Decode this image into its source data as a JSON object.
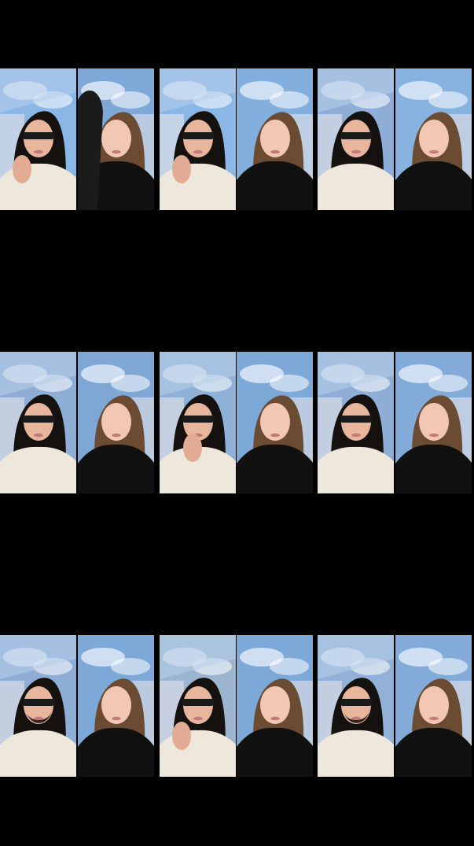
{
  "rows": [
    {
      "tiles": [
        {
          "scene": "A",
          "pose": "hand-chin",
          "sky": "#8bb7e6",
          "building": "#d6d9e6"
        },
        {
          "scene": "B",
          "pose": "hug",
          "sky": "#7ea8d8",
          "building": "#cdd4e1"
        },
        {
          "scene": "A",
          "pose": "hands-together",
          "sky": "#8bb7e6",
          "building": "#d8dce7"
        },
        {
          "scene": "B",
          "pose": "neutral",
          "sky": "#83afdf",
          "building": "#d2d8e4"
        },
        {
          "scene": "A",
          "pose": "neutral",
          "sky": "#8eaed8",
          "building": "#d4d8e4"
        },
        {
          "scene": "B",
          "pose": "neutral",
          "sky": "#87b2e0",
          "building": "#d0d6e2"
        }
      ]
    },
    {
      "tiles": [
        {
          "scene": "A",
          "pose": "neutral",
          "sky": "#8faed5",
          "building": "#d4d8e4"
        },
        {
          "scene": "B",
          "pose": "side-look",
          "sky": "#7ea7d6",
          "building": "#d2d6e2"
        },
        {
          "scene": "A",
          "pose": "finger-lip",
          "sky": "#8fb1d8",
          "building": "#d6dae6"
        },
        {
          "scene": "B",
          "pose": "neutral",
          "sky": "#7da9d8",
          "building": "#d0d6e2"
        },
        {
          "scene": "A",
          "pose": "neutral",
          "sky": "#8eaed5",
          "building": "#d4d8e4"
        },
        {
          "scene": "B",
          "pose": "side-look",
          "sky": "#82abd9",
          "building": "#d3d8e4"
        }
      ]
    },
    {
      "tiles": [
        {
          "scene": "A",
          "pose": "beard",
          "sky": "#8faed5",
          "building": "#d4d8e4"
        },
        {
          "scene": "B",
          "pose": "neutral",
          "sky": "#7da9d8",
          "building": "#d0d6e2"
        },
        {
          "scene": "A",
          "pose": "hands-together",
          "sky": "#9cb5cf",
          "building": "#d6dae6"
        },
        {
          "scene": "B",
          "pose": "neutral",
          "sky": "#7da9d8",
          "building": "#d0d6e2"
        },
        {
          "scene": "A",
          "pose": "beard",
          "sky": "#93b1d8",
          "building": "#d4d8e4"
        },
        {
          "scene": "B",
          "pose": "neutral",
          "sky": "#82abd9",
          "building": "#d3d8e4"
        }
      ]
    }
  ]
}
